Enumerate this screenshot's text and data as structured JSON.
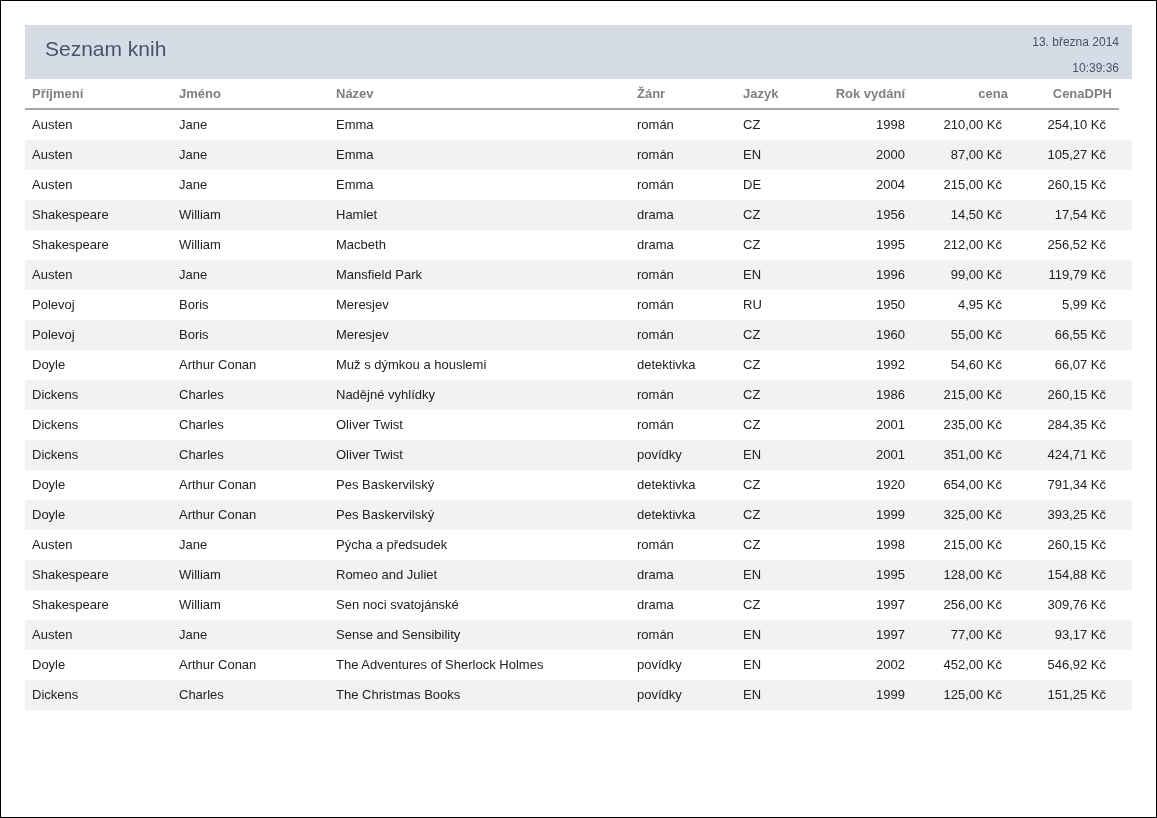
{
  "report": {
    "title": "Seznam knih",
    "date": "13. března 2014",
    "time": "10:39:36"
  },
  "table": {
    "columns": [
      "Příjmení",
      "Jméno",
      "Název",
      "Žánr",
      "Jazyk",
      "Rok vydání",
      "cena",
      "CenaDPH"
    ],
    "rows": [
      [
        "Austen",
        "Jane",
        "Emma",
        "román",
        "CZ",
        "1998",
        "210,00 Kč",
        "254,10 Kč"
      ],
      [
        "Austen",
        "Jane",
        "Emma",
        "román",
        "EN",
        "2000",
        "87,00 Kč",
        "105,27 Kč"
      ],
      [
        "Austen",
        "Jane",
        "Emma",
        "román",
        "DE",
        "2004",
        "215,00 Kč",
        "260,15 Kč"
      ],
      [
        "Shakespeare",
        "William",
        "Hamlet",
        "drama",
        "CZ",
        "1956",
        "14,50 Kč",
        "17,54 Kč"
      ],
      [
        "Shakespeare",
        "William",
        "Macbeth",
        "drama",
        "CZ",
        "1995",
        "212,00 Kč",
        "256,52 Kč"
      ],
      [
        "Austen",
        "Jane",
        "Mansfield Park",
        "román",
        "EN",
        "1996",
        "99,00 Kč",
        "119,79 Kč"
      ],
      [
        "Polevoj",
        "Boris",
        "Meresjev",
        "román",
        "RU",
        "1950",
        "4,95 Kč",
        "5,99 Kč"
      ],
      [
        "Polevoj",
        "Boris",
        "Meresjev",
        "román",
        "CZ",
        "1960",
        "55,00 Kč",
        "66,55 Kč"
      ],
      [
        "Doyle",
        "Arthur Conan",
        "Muž s dýmkou a houslemi",
        "detektivka",
        "CZ",
        "1992",
        "54,60 Kč",
        "66,07 Kč"
      ],
      [
        "Dickens",
        "Charles",
        "Nadějné vyhlídky",
        "román",
        "CZ",
        "1986",
        "215,00 Kč",
        "260,15 Kč"
      ],
      [
        "Dickens",
        "Charles",
        "Oliver Twist",
        "román",
        "CZ",
        "2001",
        "235,00 Kč",
        "284,35 Kč"
      ],
      [
        "Dickens",
        "Charles",
        "Oliver Twist",
        "povídky",
        "EN",
        "2001",
        "351,00 Kč",
        "424,71 Kč"
      ],
      [
        "Doyle",
        "Arthur Conan",
        "Pes Baskervilský",
        "detektivka",
        "CZ",
        "1920",
        "654,00 Kč",
        "791,34 Kč"
      ],
      [
        "Doyle",
        "Arthur Conan",
        "Pes Baskervilský",
        "detektivka",
        "CZ",
        "1999",
        "325,00 Kč",
        "393,25 Kč"
      ],
      [
        "Austen",
        "Jane",
        "Pýcha a předsudek",
        "román",
        "CZ",
        "1998",
        "215,00 Kč",
        "260,15 Kč"
      ],
      [
        "Shakespeare",
        "William",
        "Romeo and Juliet",
        "drama",
        "EN",
        "1995",
        "128,00 Kč",
        "154,88 Kč"
      ],
      [
        "Shakespeare",
        "William",
        "Sen noci svatojánské",
        "drama",
        "CZ",
        "1997",
        "256,00 Kč",
        "309,76 Kč"
      ],
      [
        "Austen",
        "Jane",
        "Sense and Sensibility",
        "román",
        "EN",
        "1997",
        "77,00 Kč",
        "93,17 Kč"
      ],
      [
        "Doyle",
        "Arthur Conan",
        "The Adventures of Sherlock Holmes",
        "povídky",
        "EN",
        "2002",
        "452,00 Kč",
        "546,92 Kč"
      ],
      [
        "Dickens",
        "Charles",
        "The Christmas Books",
        "povídky",
        "EN",
        "1999",
        "125,00 Kč",
        "151,25 Kč"
      ]
    ]
  }
}
